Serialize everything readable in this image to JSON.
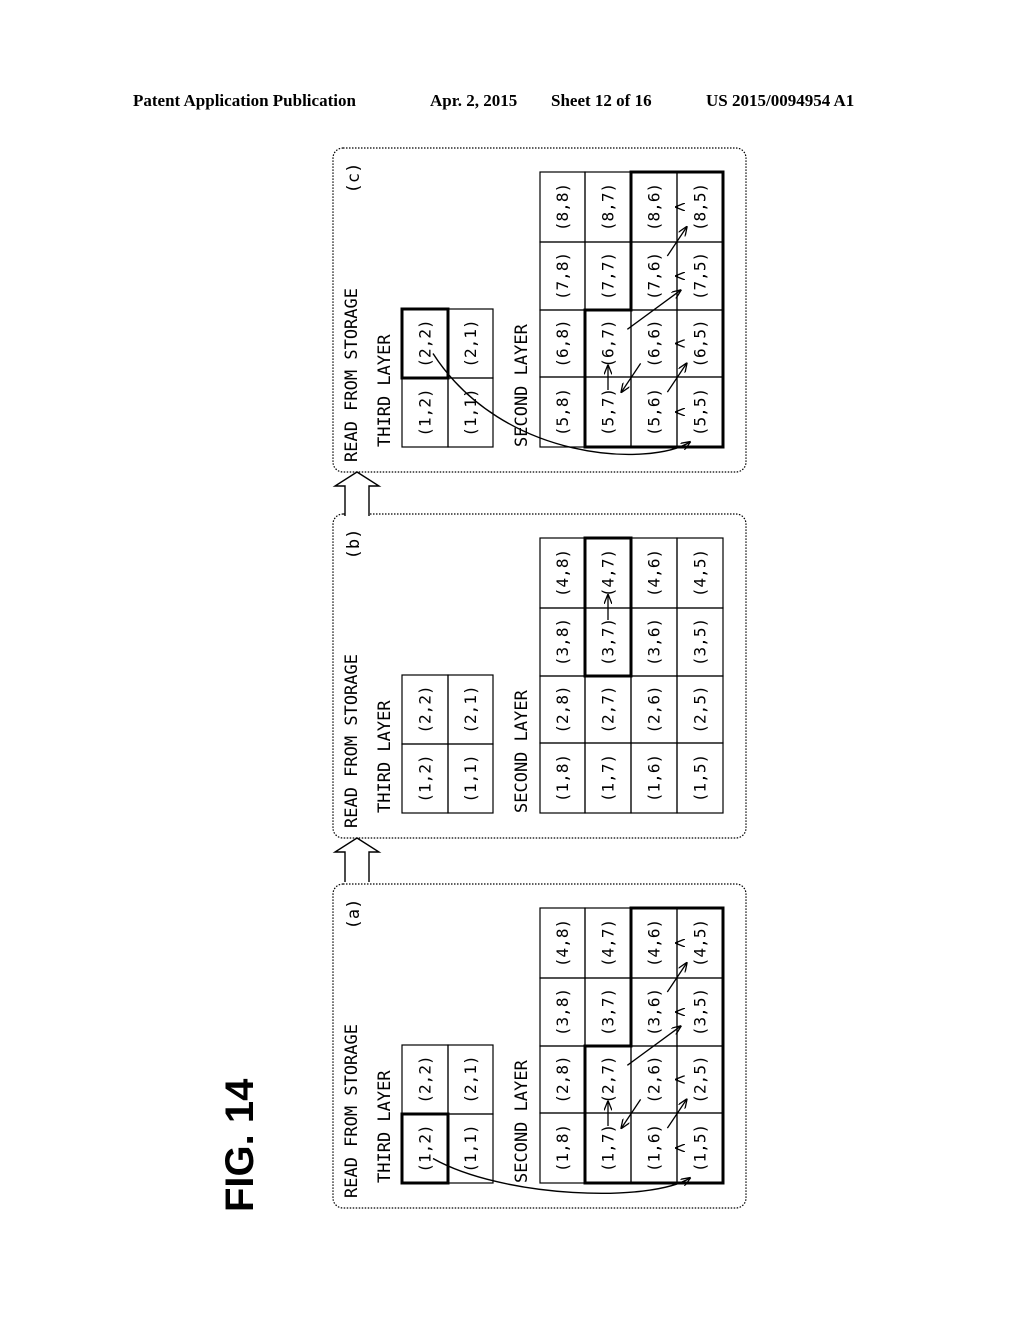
{
  "header": {
    "left": "Patent Application Publication",
    "date": "Apr. 2, 2015",
    "sheet": "Sheet 12 of 16",
    "pub_number": "US 2015/0094954 A1"
  },
  "figure": {
    "label": "FIG. 14",
    "panels": [
      {
        "id": "a",
        "tag": "(a)",
        "title": "READ FROM STORAGE",
        "third_layer_label": "THIRD LAYER",
        "second_layer_label": "SECOND LAYER",
        "third_layer": [
          [
            "(1,2)",
            "(2,2)"
          ],
          [
            "(1,1)",
            "(2,1)"
          ]
        ],
        "third_highlight": "(1,2)",
        "second_layer": [
          [
            "(1,8)",
            "(2,8)",
            "(3,8)",
            "(4,8)"
          ],
          [
            "(1,7)",
            "(2,7)",
            "(3,7)",
            "(4,7)"
          ],
          [
            "(1,6)",
            "(2,6)",
            "(3,6)",
            "(4,6)"
          ],
          [
            "(1,5)",
            "(2,5)",
            "(3,5)",
            "(4,5)"
          ]
        ],
        "second_highlight": [
          "(1,7)",
          "(2,7)",
          "(1,6)",
          "(2,6)",
          "(3,6)",
          "(4,6)",
          "(1,5)",
          "(2,5)",
          "(3,5)",
          "(4,5)"
        ],
        "scan_order": [
          "(1,5)",
          "(1,6)",
          "(2,5)",
          "(2,6)",
          "(1,7)",
          "(2,7)",
          "(3,5)",
          "(3,6)",
          "(4,5)",
          "(4,6)"
        ]
      },
      {
        "id": "b",
        "tag": "(b)",
        "title": "READ FROM STORAGE",
        "third_layer_label": "THIRD LAYER",
        "second_layer_label": "SECOND LAYER",
        "third_layer": [
          [
            "(1,2)",
            "(2,2)"
          ],
          [
            "(1,1)",
            "(2,1)"
          ]
        ],
        "third_highlight": "",
        "second_layer": [
          [
            "(1,8)",
            "(2,8)",
            "(3,8)",
            "(4,8)"
          ],
          [
            "(1,7)",
            "(2,7)",
            "(3,7)",
            "(4,7)"
          ],
          [
            "(1,6)",
            "(2,6)",
            "(3,6)",
            "(4,6)"
          ],
          [
            "(1,5)",
            "(2,5)",
            "(3,5)",
            "(4,5)"
          ]
        ],
        "second_highlight": [
          "(3,7)",
          "(4,7)"
        ],
        "scan_order": [
          "(3,7)",
          "(4,7)"
        ]
      },
      {
        "id": "c",
        "tag": "(c)",
        "title": "READ FROM STORAGE",
        "third_layer_label": "THIRD LAYER",
        "second_layer_label": "SECOND LAYER",
        "third_layer": [
          [
            "(1,2)",
            "(2,2)"
          ],
          [
            "(1,1)",
            "(2,1)"
          ]
        ],
        "third_highlight": "(2,2)",
        "second_layer": [
          [
            "(5,8)",
            "(6,8)",
            "(7,8)",
            "(8,8)"
          ],
          [
            "(5,7)",
            "(6,7)",
            "(7,7)",
            "(8,7)"
          ],
          [
            "(5,6)",
            "(6,6)",
            "(7,6)",
            "(8,6)"
          ],
          [
            "(5,5)",
            "(6,5)",
            "(7,5)",
            "(8,5)"
          ]
        ],
        "second_highlight": [
          "(5,7)",
          "(6,7)",
          "(5,6)",
          "(6,6)",
          "(7,6)",
          "(8,6)",
          "(5,5)",
          "(6,5)",
          "(7,5)",
          "(8,5)"
        ],
        "scan_order": [
          "(5,5)",
          "(5,6)",
          "(6,5)",
          "(6,6)",
          "(5,7)",
          "(6,7)",
          "(7,5)",
          "(7,6)",
          "(8,5)",
          "(8,6)"
        ]
      }
    ]
  }
}
